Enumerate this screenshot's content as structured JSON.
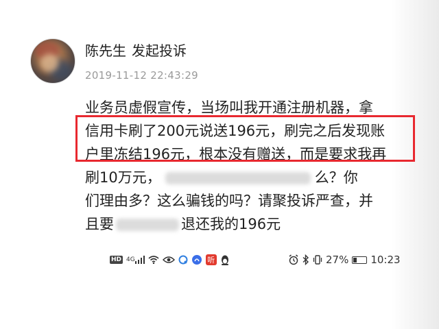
{
  "post": {
    "author": "陈先生",
    "action": "发起投诉",
    "timestamp": "2019-11-12 22:43:29",
    "lines": [
      "业务员虚假宣传，当场叫我开通注册机器，拿",
      "信用卡刷了200元说送196元，刷完之后发现账",
      "户里冻结196元，根本没有赠送，而是要求我再",
      "刷10万元，",
      "么？你",
      "们理由多？这么骗钱的吗？请聚投诉严查，并",
      "且要",
      "退还我的196元"
    ]
  },
  "statusbar": {
    "hd": "HD",
    "network": "4G",
    "battery_percent": "27%",
    "battery_level": 0.27,
    "time": "10:23",
    "icons_left": [
      "hd-icon",
      "signal-4g-icon",
      "wifi-icon",
      "eye-icon",
      "circle-app-icon",
      "baidu-app-icon",
      "ting-app-icon",
      "qq-penguin-icon"
    ],
    "icons_right": [
      "alarm-icon",
      "bluetooth-icon",
      "vibrate-icon",
      "battery-icon"
    ],
    "ting_label": "听"
  },
  "colors": {
    "highlight_border": "#e8282f",
    "text": "#222222",
    "timestamp": "#9a9a9a"
  }
}
